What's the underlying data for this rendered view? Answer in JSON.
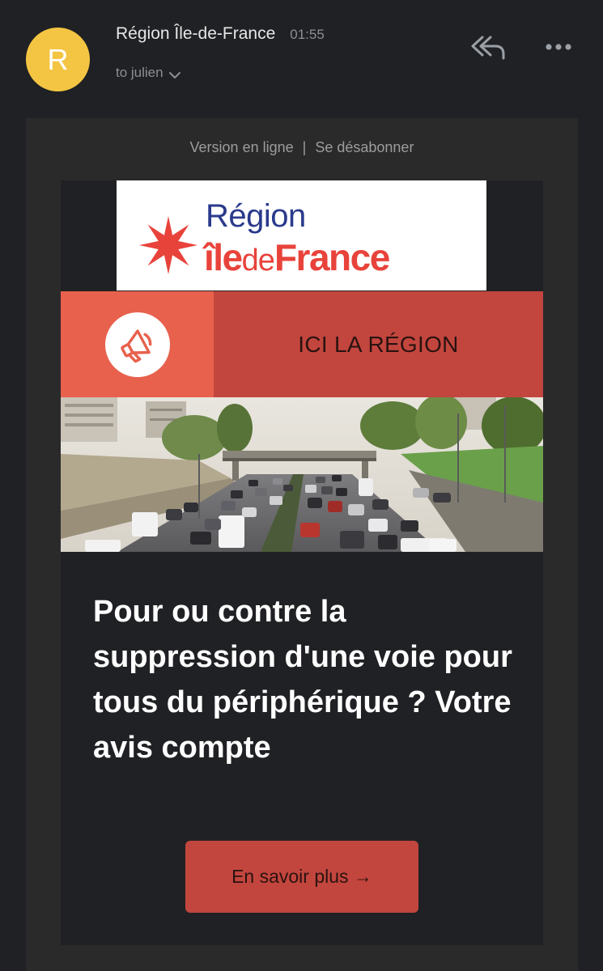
{
  "header": {
    "avatar_letter": "R",
    "avatar_color": "#F4C542",
    "sender": "Région Île-de-France",
    "time": "01:55",
    "recipient": "to julien",
    "icons": [
      "chevron-down-icon",
      "reply-all-icon",
      "more-icon"
    ]
  },
  "email": {
    "links": {
      "online": "Version en ligne",
      "separator": "|",
      "unsubscribe": "Se désabonner"
    },
    "logo": {
      "line1": "Région",
      "line2_a": "île",
      "line2_b": "de",
      "line2_c": "France",
      "brand_red": "#E8433B",
      "brand_blue": "#2a3a8c"
    },
    "banner": {
      "title": "ICI LA RÉGION",
      "icon": "megaphone-icon",
      "left_color": "#E8614D",
      "right_color": "#C2463E"
    },
    "photo": {
      "subject": "traffic-on-highway-photo"
    },
    "headline": "Pour ou contre la suppression d'une voie pour tous du périphérique ? Votre avis compte",
    "cta": {
      "label": "En savoir plus →",
      "color": "#C2463E"
    }
  }
}
